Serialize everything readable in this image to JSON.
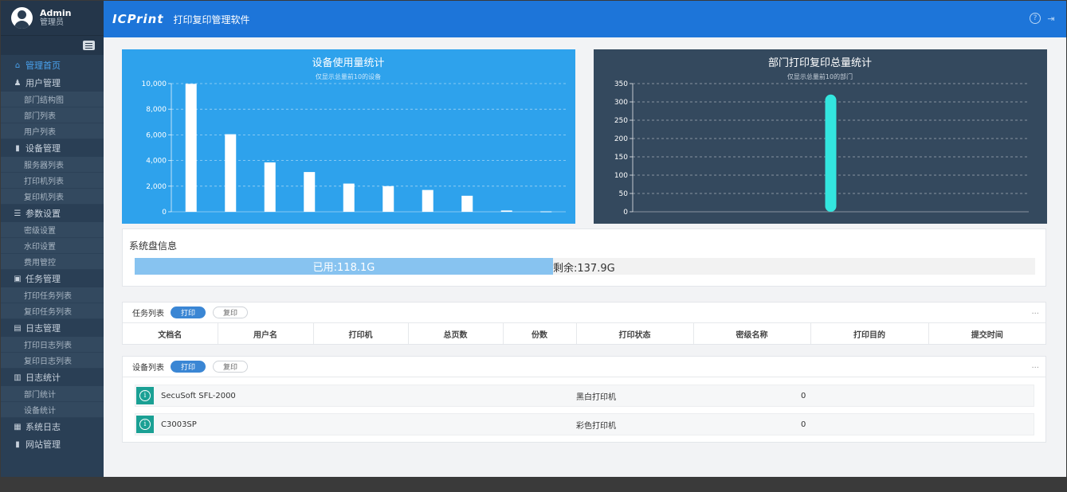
{
  "profile": {
    "name": "Admin",
    "role": "管理员"
  },
  "header": {
    "logo": "ICPrint",
    "title": "打印复印管理软件",
    "help_icon": "?",
    "logout_icon": "⇥"
  },
  "menu": [
    {
      "label": "管理首页",
      "icon": "⌂",
      "active": true,
      "children": []
    },
    {
      "label": "用户管理",
      "icon": "♟",
      "children": [
        "部门结构图",
        "部门列表",
        "用户列表"
      ]
    },
    {
      "label": "设备管理",
      "icon": "▮",
      "children": [
        "服务器列表",
        "打印机列表",
        "复印机列表"
      ]
    },
    {
      "label": "参数设置",
      "icon": "☰",
      "children": [
        "密级设置",
        "水印设置",
        "费用管控"
      ]
    },
    {
      "label": "任务管理",
      "icon": "▣",
      "children": [
        "打印任务列表",
        "复印任务列表"
      ]
    },
    {
      "label": "日志管理",
      "icon": "▤",
      "children": [
        "打印日志列表",
        "复印日志列表"
      ]
    },
    {
      "label": "日志统计",
      "icon": "▥",
      "children": [
        "部门统计",
        "设备统计"
      ]
    },
    {
      "label": "系统日志",
      "icon": "▦",
      "children": []
    },
    {
      "label": "网站管理",
      "icon": "▮",
      "children": []
    }
  ],
  "chart_data": [
    {
      "type": "bar",
      "title": "设备使用量统计",
      "subtitle": "仅显示总量前10的设备",
      "values": [
        9980,
        6050,
        3850,
        3100,
        2200,
        2000,
        1700,
        1250,
        100,
        30
      ],
      "ylim": [
        0,
        10000
      ],
      "yticks": [
        "0",
        "2,000",
        "4,000",
        "6,000",
        "8,000",
        "10,000"
      ],
      "grid": true,
      "bar_color": "#ffffff",
      "background": "#2ea2ec"
    },
    {
      "type": "bar",
      "title": "部门打印复印总量统计",
      "subtitle": "仅显示总量前10的部门",
      "values": [
        320
      ],
      "ylim": [
        0,
        350
      ],
      "yticks": [
        "0",
        "50",
        "100",
        "150",
        "200",
        "250",
        "300",
        "350"
      ],
      "grid": true,
      "bar_color": "#33e6df",
      "background": "#34495e"
    }
  ],
  "disk": {
    "title": "系统盘信息",
    "used_label": "已用:118.1G",
    "free_label": "剩余:137.9G",
    "used_gb": 118.1,
    "free_gb": 137.9
  },
  "tasks": {
    "title": "任务列表",
    "tab_print": "打印",
    "tab_copy": "复印",
    "more": "...",
    "columns": [
      "文档名",
      "用户名",
      "打印机",
      "总页数",
      "份数",
      "打印状态",
      "密级名称",
      "打印目的",
      "提交时间"
    ]
  },
  "devices": {
    "title": "设备列表",
    "tab_print": "打印",
    "tab_copy": "复印",
    "more": "...",
    "rows": [
      {
        "name": "SecuSoft SFL-2000",
        "type": "黑白打印机",
        "count": "0"
      },
      {
        "name": "C3003SP",
        "type": "彩色打印机",
        "count": "0"
      }
    ]
  }
}
